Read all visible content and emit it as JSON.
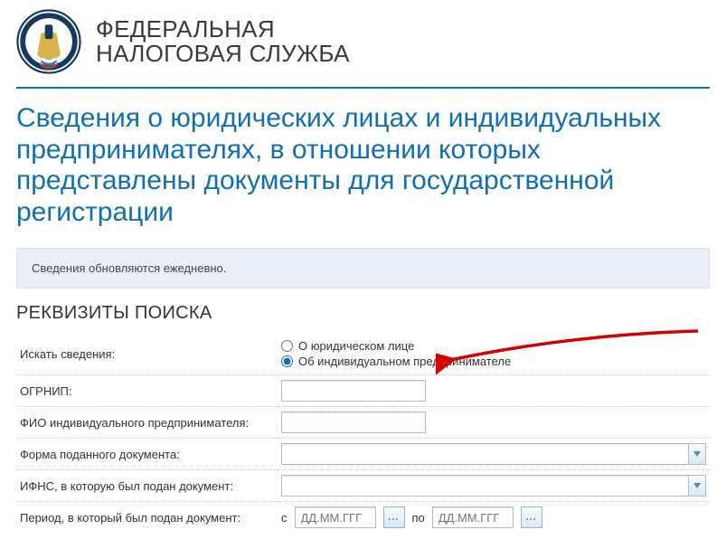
{
  "agency": {
    "line1": "ФЕДЕРАЛЬНАЯ",
    "line2": "НАЛОГОВАЯ СЛУЖБА"
  },
  "page_title": "Сведения о юридических лицах и индивидуальных предпринимателях, в отношении которых представлены документы для государственной регистрации",
  "banner": "Сведения обновляются ежедневно.",
  "section_heading": "РЕКВИЗИТЫ ПОИСКА",
  "labels": {
    "search_for": "Искать сведения:",
    "ogrnip": "ОГРНИП:",
    "fio": "ФИО индивидуального предпринимателя:",
    "doc_form": "Форма поданного документа:",
    "ifns": "ИФНС, в которую был подан документ:",
    "period": "Период, в который был подан документ:"
  },
  "radios": {
    "legal": "О юридическом лице",
    "individual": "Об индивидуальном предпринимателе"
  },
  "period": {
    "from_prefix": "с",
    "to_prefix": "по",
    "date_placeholder": "ДД.ММ.ГГГ",
    "picker_glyph": "..."
  },
  "ogrnip_value": "",
  "fio_value": ""
}
